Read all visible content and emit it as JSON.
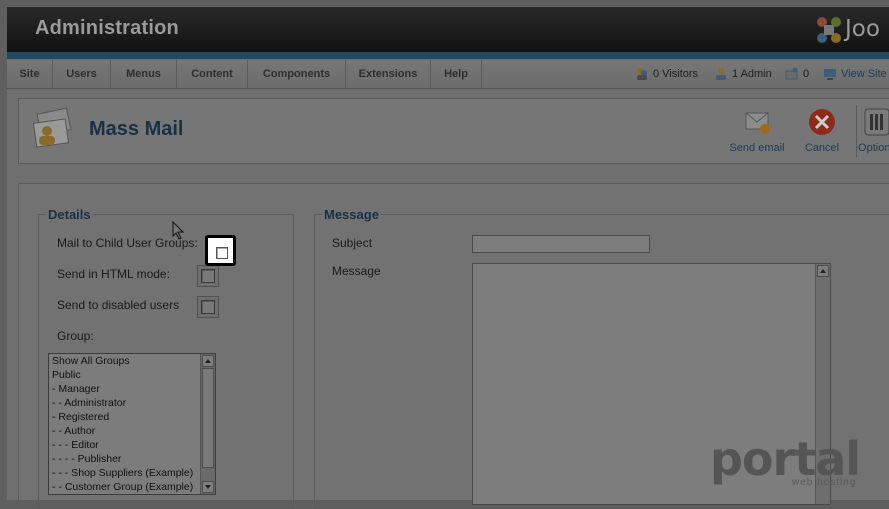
{
  "header": {
    "title": "Administration",
    "logo_text": "Joo",
    "stripe_color": "#1b4b63"
  },
  "menubar": {
    "items": [
      "Site",
      "Users",
      "Menus",
      "Content",
      "Components",
      "Extensions",
      "Help"
    ],
    "status": {
      "visitors": "0 Visitors",
      "admins": "1 Admin",
      "messages": "0",
      "view_site": "View Site"
    }
  },
  "toolbar": {
    "page_title": "Mass Mail",
    "send_email_label": "Send email",
    "cancel_label": "Cancel",
    "options_label": "Options"
  },
  "details": {
    "legend": "Details",
    "mail_child_groups_label": "Mail to Child User Groups:",
    "html_mode_label": "Send in HTML mode:",
    "disabled_users_label": "Send to disabled users",
    "group_label": "Group:",
    "groups": [
      "Show All Groups",
      "Public",
      "- Manager",
      "- - Administrator",
      "- Registered",
      "- - Author",
      "- - - Editor",
      "- - - - Publisher",
      "- - - Shop Suppliers (Example)",
      "- - Customer Group (Example)"
    ]
  },
  "message": {
    "legend": "Message",
    "subject_label": "Subject",
    "subject_value": "",
    "message_label": "Message",
    "message_value": ""
  },
  "watermark": {
    "text": "portal",
    "subtext": "web hosting"
  }
}
